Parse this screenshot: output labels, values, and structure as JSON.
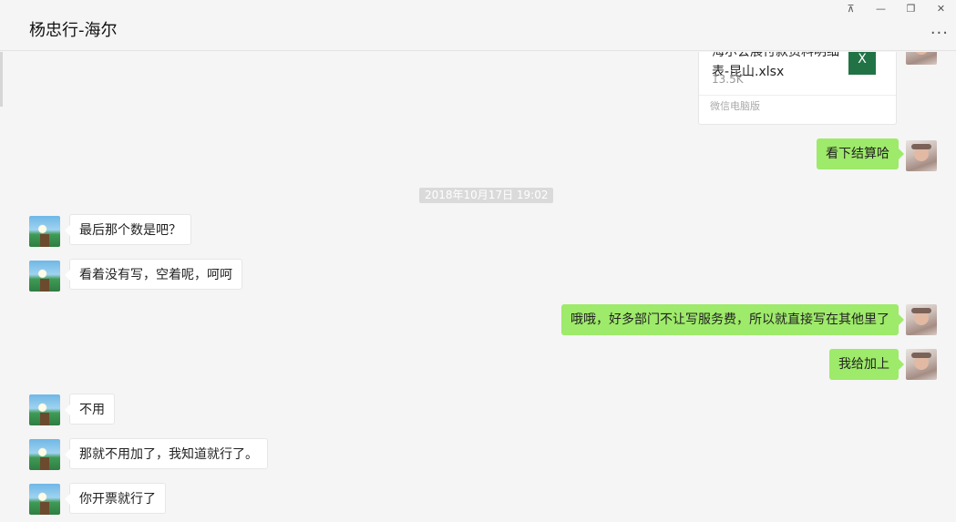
{
  "window": {
    "title": "杨忠行-海尔",
    "controls": {
      "pin": "⊼",
      "minimize": "—",
      "restore": "❐",
      "close": "✕"
    },
    "more": "···"
  },
  "file_message": {
    "file_name": "海尔会展付款资料明细表-昆山.xlsx",
    "file_size": "13.5K",
    "source": "微信电脑版",
    "file_icon_letter": "X"
  },
  "timestamp": "2018年10月17日 19:02",
  "messages": {
    "m1": "看下结算哈",
    "m2": "最后那个数是吧？",
    "m3": "看着没有写，空着呢，呵呵",
    "m4": "哦哦，好多部门不让写服务费，所以就直接写在其他里了",
    "m5": "我给加上",
    "m6": "不用",
    "m7": "那就不用加了，我知道就行了。",
    "m8": "你开票就行了"
  },
  "colors": {
    "self_bubble": "#9eea6a",
    "peer_bubble": "#ffffff",
    "excel": "#217346"
  }
}
